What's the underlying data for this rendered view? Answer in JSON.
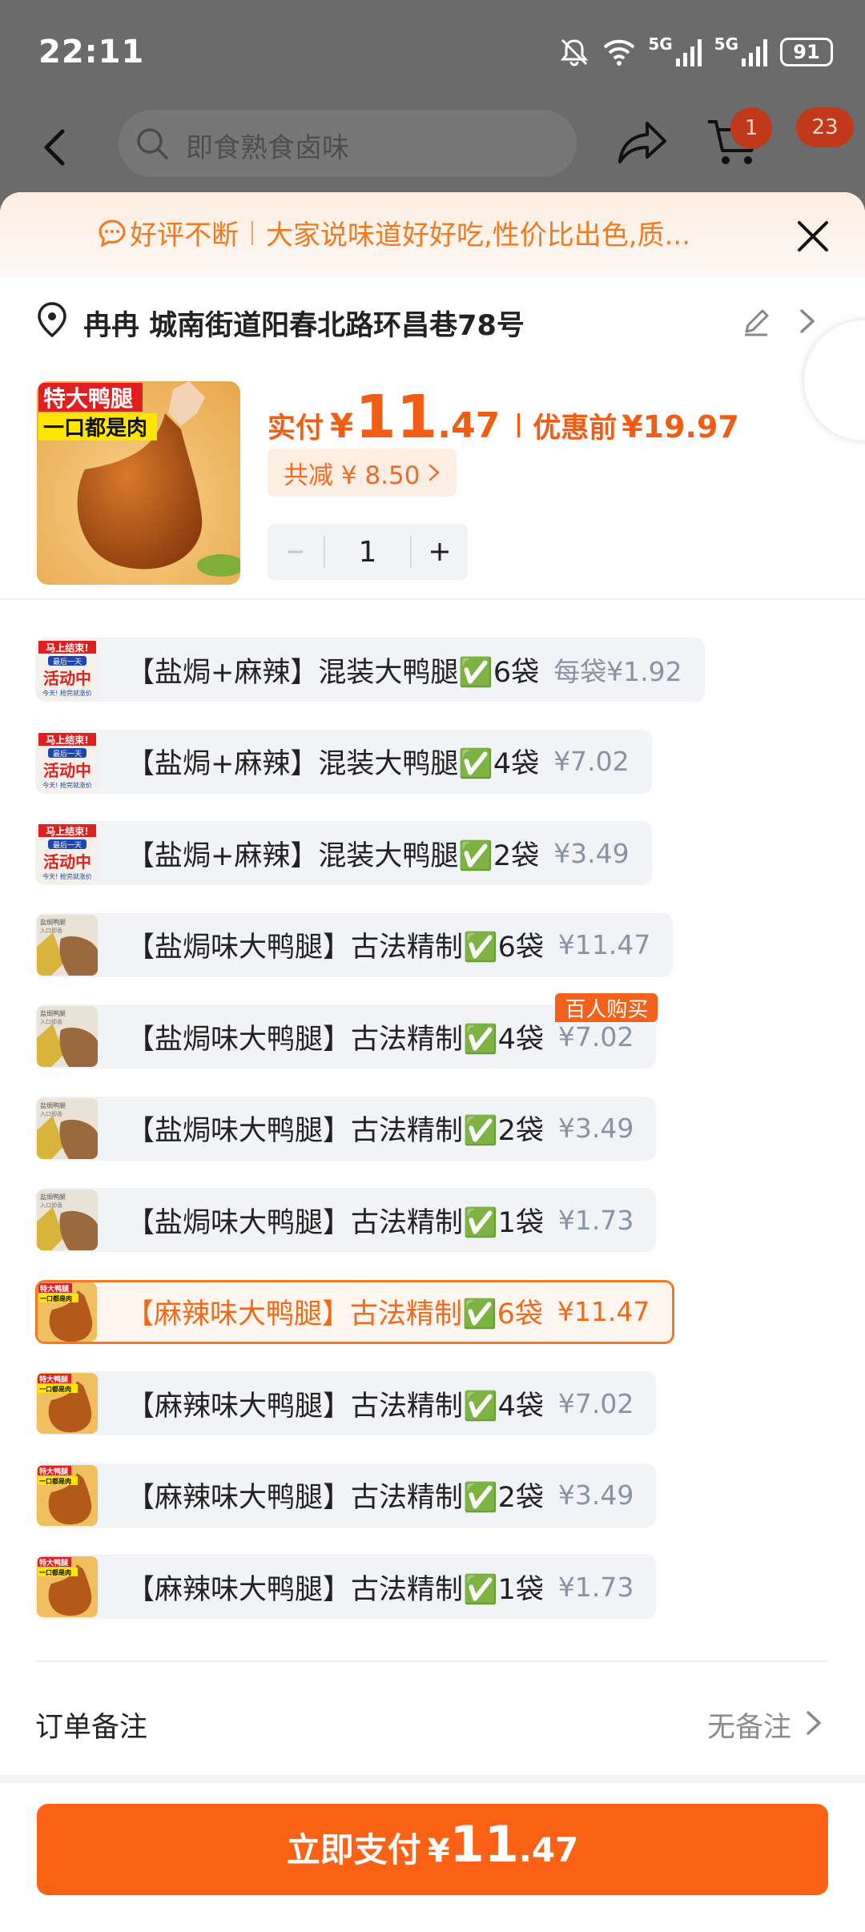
{
  "status_bar": {
    "time": "22:11",
    "battery": "91",
    "signal1_label": "5G",
    "signal2_label": "5G"
  },
  "background_nav": {
    "search_placeholder": "即食熟食卤味",
    "cart_badge": "1",
    "message_badge": "23"
  },
  "banner": {
    "tag": "好评不断",
    "text": "大家说味道好好吃,性价比出色,质..."
  },
  "address": {
    "text": "冉冉 城南街道阳春北路环昌巷78号"
  },
  "product": {
    "thumb_line1": "特大鸭腿",
    "thumb_line2": "一口都是肉",
    "pay_label": "实付",
    "pay_yen": "¥",
    "pay_int": "11",
    "pay_dec": ".47",
    "orig_label": "优惠前",
    "orig_price": "¥19.97",
    "discount_text": "共减 ¥ 8.50",
    "quantity": "1"
  },
  "sku_thumb_labels": {
    "promo_top": "马上结束!",
    "promo_mid": "最后一天",
    "promo_main": "活动中",
    "promo_bottom": "今天! 抢完就涨价",
    "plain_top": "盐焗鸭腿",
    "plain_bottom": "入口即香",
    "spicy_top": "特大鸭腿",
    "spicy_bottom": "一口都是肉"
  },
  "skus": [
    {
      "name": "【盐焗+麻辣】混装大鸭腿✅6袋",
      "price": "每袋¥1.92",
      "thumb": "promo",
      "selected": false,
      "badge": ""
    },
    {
      "name": "【盐焗+麻辣】混装大鸭腿✅4袋",
      "price": "¥7.02",
      "thumb": "promo",
      "selected": false,
      "badge": ""
    },
    {
      "name": "【盐焗+麻辣】混装大鸭腿✅2袋",
      "price": "¥3.49",
      "thumb": "promo",
      "selected": false,
      "badge": ""
    },
    {
      "name": "【盐焗味大鸭腿】古法精制✅6袋",
      "price": "¥11.47",
      "thumb": "plain",
      "selected": false,
      "badge": ""
    },
    {
      "name": "【盐焗味大鸭腿】古法精制✅4袋",
      "price": "¥7.02",
      "thumb": "plain",
      "selected": false,
      "badge": "百人购买"
    },
    {
      "name": "【盐焗味大鸭腿】古法精制✅2袋",
      "price": "¥3.49",
      "thumb": "plain",
      "selected": false,
      "badge": ""
    },
    {
      "name": "【盐焗味大鸭腿】古法精制✅1袋",
      "price": "¥1.73",
      "thumb": "plain",
      "selected": false,
      "badge": ""
    },
    {
      "name": "【麻辣味大鸭腿】古法精制✅6袋",
      "price": "¥11.47",
      "thumb": "spicy",
      "selected": true,
      "badge": ""
    },
    {
      "name": "【麻辣味大鸭腿】古法精制✅4袋",
      "price": "¥7.02",
      "thumb": "spicy",
      "selected": false,
      "badge": ""
    },
    {
      "name": "【麻辣味大鸭腿】古法精制✅2袋",
      "price": "¥3.49",
      "thumb": "spicy",
      "selected": false,
      "badge": ""
    },
    {
      "name": "【麻辣味大鸭腿】古法精制✅1袋",
      "price": "¥1.73",
      "thumb": "spicy",
      "selected": false,
      "badge": ""
    }
  ],
  "remark": {
    "label": "订单备注",
    "value": "无备注"
  },
  "pay_button": {
    "label": "立即支付",
    "yen": "¥",
    "int": "11",
    "dec": ".47"
  },
  "colors": {
    "accent": "#fb6216",
    "banner_text": "#f07a1f",
    "sku_bg": "#f2f3f6",
    "overlay": "#6b6b6b"
  }
}
